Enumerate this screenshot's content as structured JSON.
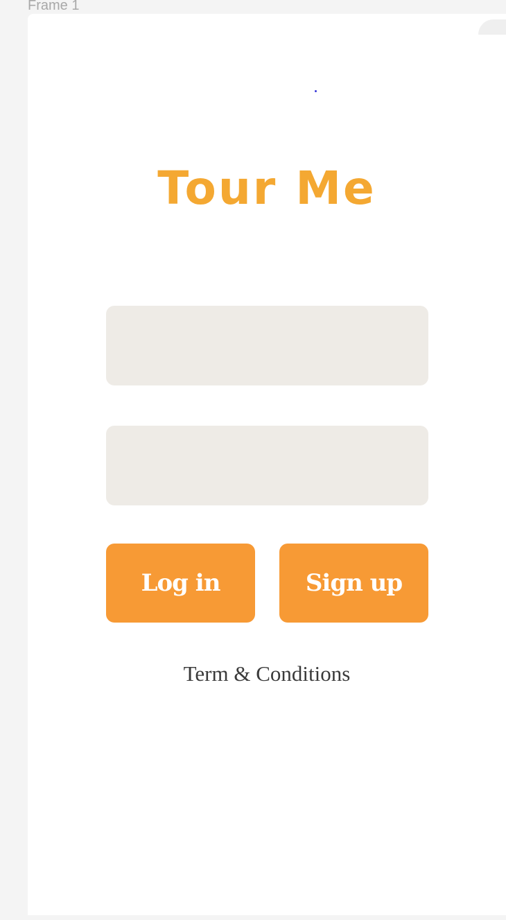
{
  "canvas": {
    "frame_label": "Frame 1"
  },
  "app": {
    "title": "Tour Me"
  },
  "form": {
    "username": {
      "value": "",
      "placeholder": ""
    },
    "password": {
      "value": "",
      "placeholder": ""
    },
    "login_label": "Log in",
    "signup_label": "Sign up",
    "terms_label": "Term & Conditions"
  },
  "colors": {
    "title": "#f4a832",
    "button": "#f79a35",
    "field": "#eeebe6",
    "text": "#3a3a3a"
  }
}
